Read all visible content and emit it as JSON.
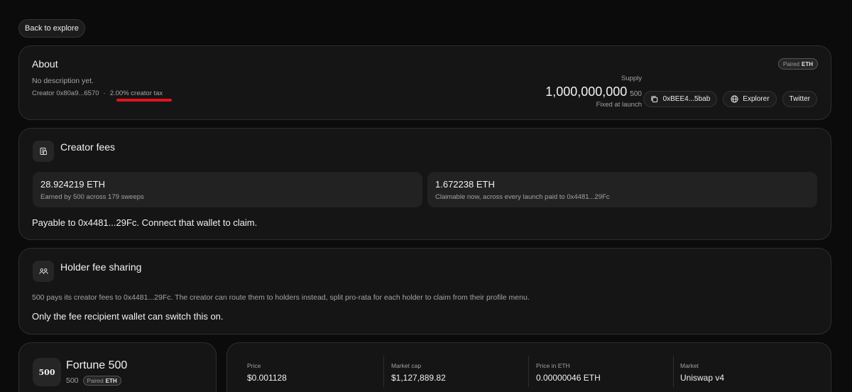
{
  "nav": {
    "back_label": "Back to explore"
  },
  "about": {
    "title": "About",
    "description": "No description yet.",
    "creator_label": "Creator 0x80a9...6570",
    "separator": "·",
    "creator_tax": "2.00% creator tax",
    "paired_prefix": "Paired",
    "paired_token": "ETH",
    "supply_label": "Supply",
    "supply_value": "1,000,000,000",
    "supply_ticker": "500",
    "supply_note": "Fixed at launch",
    "links": {
      "contract": "0xBEE4...5bab",
      "explorer": "Explorer",
      "twitter": "Twitter"
    }
  },
  "creator_fees": {
    "title": "Creator fees",
    "earned_value": "28.924219 ETH",
    "earned_sub": "Earned by 500 across 179 sweeps",
    "claimable_value": "1.672238 ETH",
    "claimable_sub": "Claimable now, across every launch paid to 0x4481...29Fc",
    "payable_note": "Payable to 0x4481...29Fc. Connect that wallet to claim."
  },
  "holder_fees": {
    "title": "Holder fee sharing",
    "description": "500 pays its creator fees to 0x4481...29Fc. The creator can route them to holders instead, split pro-rata for each holder to claim from their profile menu.",
    "note": "Only the fee recipient wallet can switch this on."
  },
  "token": {
    "logo_text": "500",
    "name": "Fortune 500",
    "ticker": "500",
    "paired_prefix": "Paired",
    "paired_token": "ETH"
  },
  "stats": [
    {
      "label": "Price",
      "value": "$0.001128"
    },
    {
      "label": "Market cap",
      "value": "$1,127,889.82"
    },
    {
      "label": "Price in ETH",
      "value": "0.00000046 ETH"
    },
    {
      "label": "Market",
      "value": "Uniswap v4"
    }
  ],
  "colors": {
    "background": "#0b0b0b",
    "card": "#151515",
    "accent_underline": "#e1141e"
  }
}
